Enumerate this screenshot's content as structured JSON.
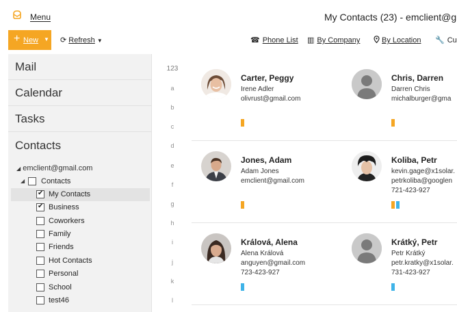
{
  "titlebar": {
    "menu_label": "Menu",
    "window_title": "My Contacts (23) - emclient@gm"
  },
  "toolbar": {
    "new_label": "New",
    "refresh_label": "Refresh",
    "phone_list_label": "Phone List",
    "by_company_label": "By Company",
    "by_location_label": "By Location",
    "customize_label": "Cus"
  },
  "sidebar": {
    "sections": [
      "Mail",
      "Calendar",
      "Tasks",
      "Contacts"
    ],
    "account": "emclient@gmail.com",
    "contacts_root": "Contacts",
    "folders": [
      {
        "label": "My Contacts",
        "checked": true
      },
      {
        "label": "Business",
        "checked": true
      },
      {
        "label": "Coworkers",
        "checked": false
      },
      {
        "label": "Family",
        "checked": false
      },
      {
        "label": "Friends",
        "checked": false
      },
      {
        "label": "Hot Contacts",
        "checked": false
      },
      {
        "label": "Personal",
        "checked": false
      },
      {
        "label": "School",
        "checked": false
      },
      {
        "label": "test46",
        "checked": false
      }
    ]
  },
  "alphabet": [
    "123",
    "a",
    "b",
    "c",
    "d",
    "e",
    "f",
    "g",
    "h",
    "i",
    "j",
    "k",
    "l"
  ],
  "contacts": [
    {
      "name": "Carter, Peggy",
      "lines": [
        "Irene Adler",
        "olivrust@gmail.com"
      ],
      "avatar": "photo-woman-smiling",
      "categories": [
        "#f5a623"
      ]
    },
    {
      "name": "Chris, Darren",
      "lines": [
        "Darren Chris",
        "michalburger@gma"
      ],
      "avatar": "generic-person",
      "categories": [
        "#f5a623"
      ]
    },
    {
      "name": "Jones, Adam",
      "lines": [
        "Adam Jones",
        "emclient@gmail.com"
      ],
      "avatar": "photo-man-suit",
      "categories": [
        "#f5a623"
      ]
    },
    {
      "name": "Koliba, Petr",
      "lines": [
        "kevin.gage@x1solar.",
        "petrkoliba@googlen",
        "721-423-927"
      ],
      "avatar": "photo-man-curly-hair",
      "categories": [
        "#f5a623",
        "#3fb3e8"
      ]
    },
    {
      "name": "Králová, Alena",
      "lines": [
        "Alena Králová",
        "anguyen@gmail.com",
        "723-423-927"
      ],
      "avatar": "photo-woman-dark-hair",
      "categories": [
        "#3fb3e8"
      ]
    },
    {
      "name": "Krátký, Petr",
      "lines": [
        "Petr Krátký",
        "petr.kratky@x1solar.",
        "731-423-927"
      ],
      "avatar": "generic-person",
      "categories": [
        "#3fb3e8"
      ]
    }
  ],
  "colors": {
    "accent": "#f5a623",
    "category_orange": "#f5a623",
    "category_blue": "#3fb3e8",
    "sidebar_bg": "#f2f2f2"
  }
}
